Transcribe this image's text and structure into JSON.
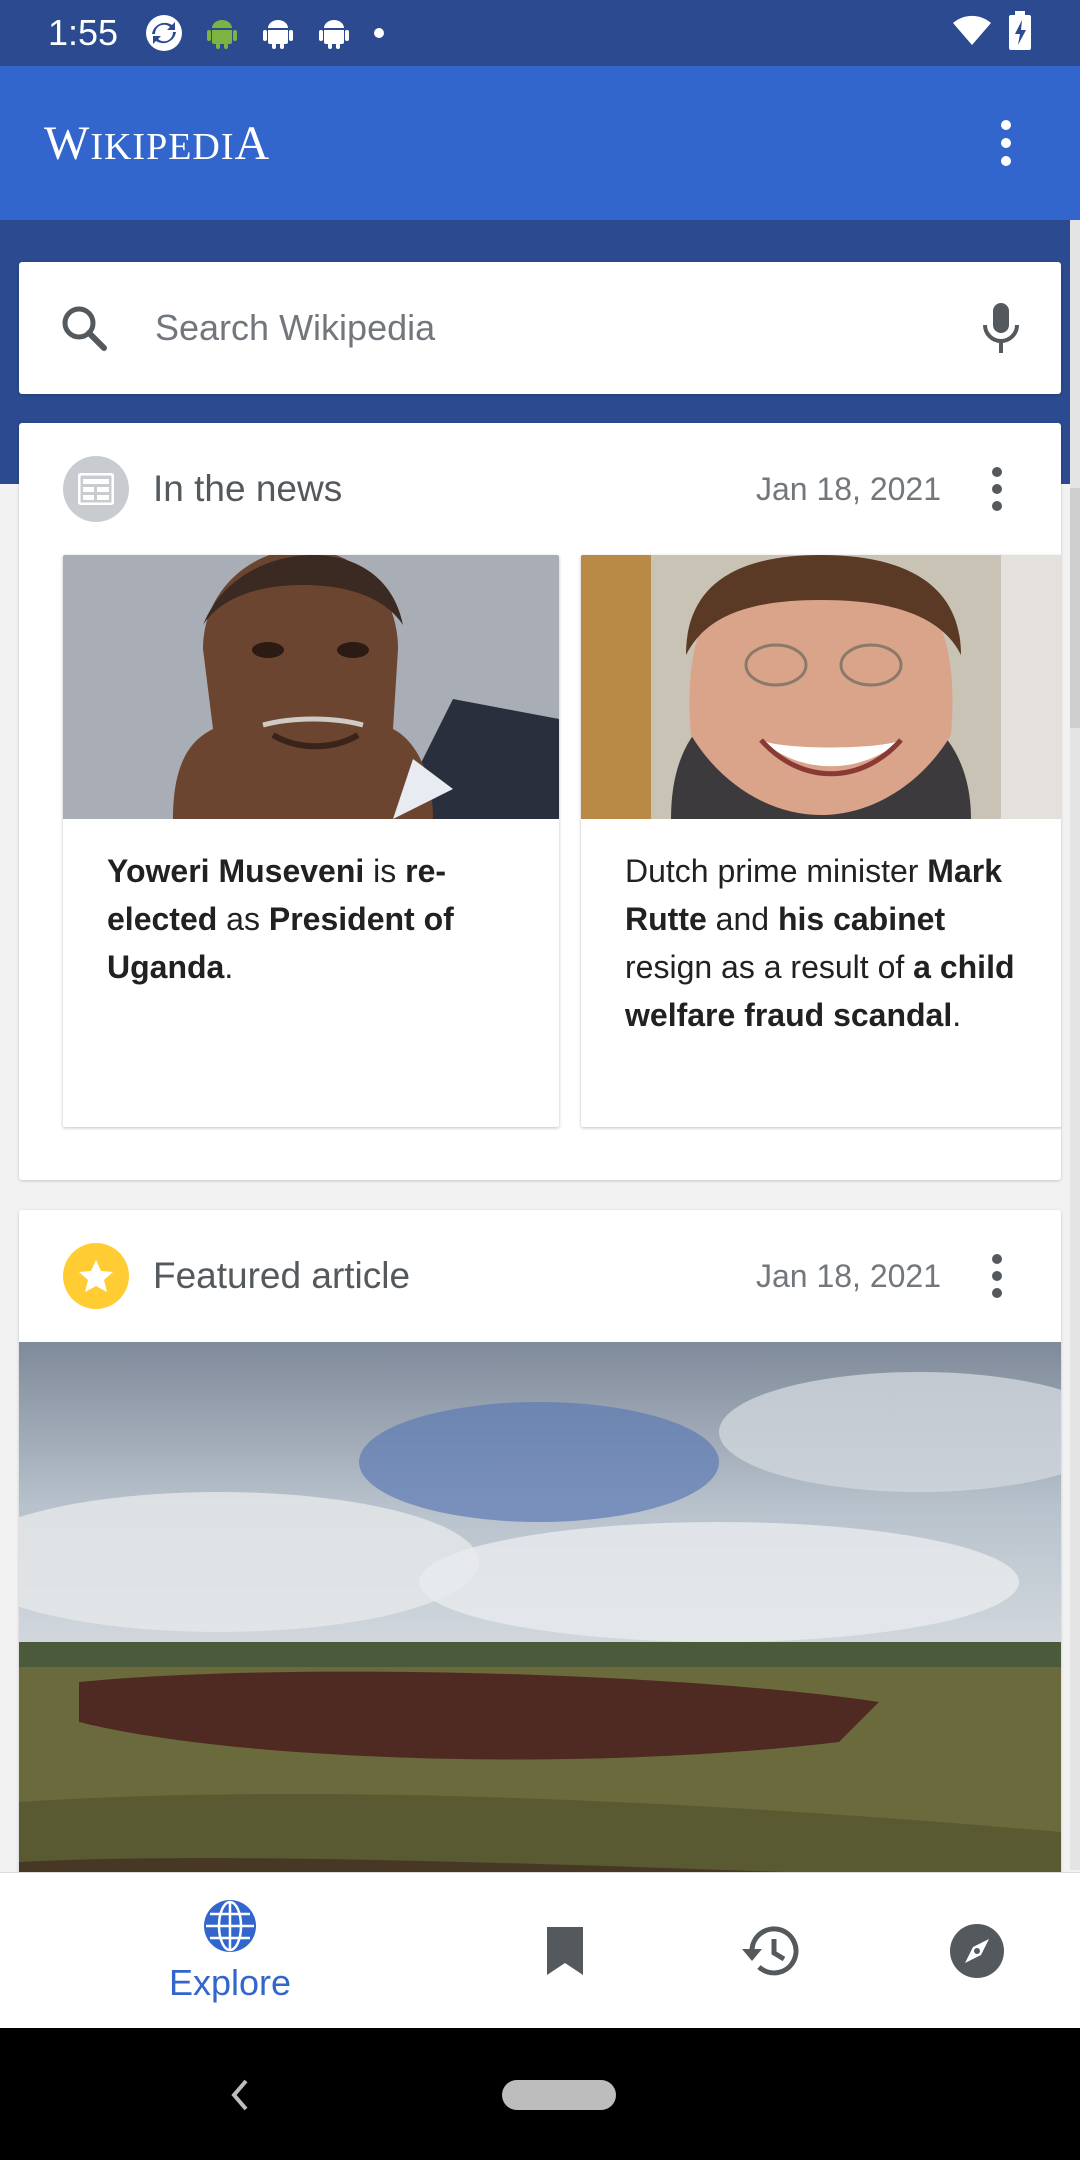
{
  "status_bar": {
    "time": "1:55"
  },
  "app_bar": {
    "logo_big_w": "W",
    "logo_mid": "IKIPEDI",
    "logo_big_a": "A"
  },
  "search": {
    "placeholder": "Search Wikipedia"
  },
  "news_card": {
    "title": "In the news",
    "date": "Jan 18, 2021",
    "items": [
      {
        "parts": [
          "Yoweri Museveni",
          " is ",
          "re-elected",
          " as ",
          "President of Uganda",
          "."
        ]
      },
      {
        "parts": [
          "Dutch prime minister ",
          "Mark Rutte",
          " and ",
          "his cabinet",
          " resign as a result of ",
          "a child welfare fraud scandal",
          "."
        ]
      }
    ]
  },
  "featured_card": {
    "title": "Featured article",
    "date": "Jan 18, 2021"
  },
  "bottom_nav": {
    "explore_label": "Explore"
  },
  "colors": {
    "primary": "#3366cc",
    "status_bar": "#2b4a8f",
    "star": "#fc3"
  }
}
